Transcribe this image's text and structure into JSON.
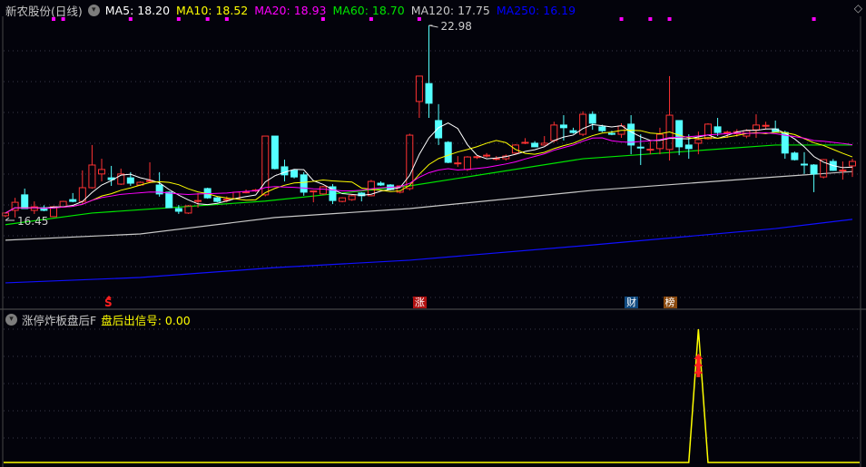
{
  "header": {
    "stock_name": "新农股份",
    "period": "(日线)",
    "ma_labels": [
      {
        "text": "MA5: 18.20",
        "color": "#ffffff"
      },
      {
        "text": "MA10: 18.52",
        "color": "#ffff00"
      },
      {
        "text": "MA20: 18.93",
        "color": "#ff00ff"
      },
      {
        "text": "MA60: 18.70",
        "color": "#00e600"
      },
      {
        "text": "MA120: 17.75",
        "color": "#c8c8c8"
      },
      {
        "text": "MA250: 16.19",
        "color": "#0000ff"
      }
    ],
    "collapse_icon": "chevron-down-circle-icon",
    "corner_icon": "diamond-icon"
  },
  "indicator": {
    "name": "涨停炸板盘后F",
    "signal_label": "盘后出信号: 0.00",
    "color": "#ffff00",
    "signal_index": 72
  },
  "annotations": {
    "high_label": "22.98",
    "low_label": "16.45",
    "s_mark": "S",
    "badges": [
      {
        "text": "涨",
        "index": 43,
        "bg": "#b01010"
      },
      {
        "text": "财",
        "index": 65,
        "bg": "#104a80"
      },
      {
        "text": "榜",
        "index": 69,
        "bg": "#8a4a10"
      }
    ]
  },
  "colors": {
    "up": "#ff3232",
    "down": "#54ffff",
    "background": "#03030b"
  },
  "chart_data": {
    "type": "candlestick",
    "title": "新农股份 (日线)",
    "ylim": [
      13.5,
      23.5
    ],
    "candles_ohlc": [
      [
        16.6,
        16.7,
        16.55,
        16.69
      ],
      [
        16.78,
        17.2,
        16.54,
        17.05
      ],
      [
        17.3,
        17.51,
        16.84,
        16.84
      ],
      [
        16.78,
        17.08,
        16.66,
        16.9
      ],
      [
        16.87,
        16.95,
        16.75,
        16.78
      ],
      [
        16.57,
        16.93,
        16.55,
        16.9
      ],
      [
        16.9,
        17.1,
        16.88,
        17.08
      ],
      [
        17.14,
        17.36,
        17.05,
        17.08
      ],
      [
        17.08,
        18.12,
        16.99,
        17.54
      ],
      [
        17.54,
        18.97,
        17.51,
        18.3
      ],
      [
        18.0,
        18.51,
        17.75,
        18.15
      ],
      [
        17.87,
        18.27,
        17.6,
        17.81
      ],
      [
        17.66,
        18.18,
        17.63,
        18.0
      ],
      [
        17.87,
        18.06,
        17.6,
        17.69
      ],
      [
        17.63,
        17.75,
        17.6,
        17.72
      ],
      [
        17.75,
        18.39,
        17.69,
        17.78
      ],
      [
        17.63,
        18.06,
        17.24,
        17.33
      ],
      [
        17.39,
        17.42,
        16.87,
        16.87
      ],
      [
        16.84,
        16.96,
        16.66,
        16.75
      ],
      [
        16.69,
        16.96,
        16.66,
        16.93
      ],
      [
        17.1,
        17.36,
        16.87,
        17.11
      ],
      [
        17.51,
        17.54,
        17.17,
        17.2
      ],
      [
        17.2,
        17.25,
        17.05,
        17.08
      ],
      [
        17.14,
        17.25,
        17.05,
        17.15
      ],
      [
        17.17,
        17.4,
        17.15,
        17.39
      ],
      [
        17.39,
        17.48,
        17.35,
        17.4
      ],
      [
        17.44,
        17.5,
        17.4,
        17.46
      ],
      [
        17.3,
        19.27,
        17.25,
        19.27
      ],
      [
        19.27,
        19.27,
        18.15,
        18.18
      ],
      [
        18.24,
        18.48,
        17.75,
        17.97
      ],
      [
        18.12,
        18.15,
        17.85,
        17.9
      ],
      [
        17.97,
        18.06,
        17.27,
        17.39
      ],
      [
        17.41,
        17.45,
        17.05,
        17.43
      ],
      [
        17.33,
        17.6,
        17.3,
        17.57
      ],
      [
        17.57,
        17.66,
        16.99,
        17.11
      ],
      [
        17.08,
        17.22,
        17.05,
        17.2
      ],
      [
        17.14,
        17.3,
        17.1,
        17.27
      ],
      [
        17.36,
        17.39,
        17.08,
        17.27
      ],
      [
        17.27,
        17.8,
        17.25,
        17.75
      ],
      [
        17.69,
        17.75,
        17.6,
        17.63
      ],
      [
        17.63,
        17.66,
        17.45,
        17.48
      ],
      [
        17.39,
        17.62,
        17.35,
        17.6
      ],
      [
        17.51,
        19.35,
        17.45,
        19.3
      ],
      [
        20.43,
        21.28,
        19.88,
        21.28
      ],
      [
        21.03,
        22.98,
        19.88,
        20.37
      ],
      [
        19.79,
        20.34,
        18.97,
        19.21
      ],
      [
        19.06,
        19.1,
        18.36,
        18.39
      ],
      [
        18.36,
        18.6,
        18.24,
        18.37
      ],
      [
        18.15,
        18.6,
        18.1,
        18.57
      ],
      [
        18.56,
        18.6,
        18.5,
        18.58
      ],
      [
        18.62,
        18.7,
        18.55,
        18.63
      ],
      [
        18.5,
        18.6,
        18.45,
        18.52
      ],
      [
        18.51,
        18.65,
        18.45,
        18.6
      ],
      [
        18.7,
        19.0,
        18.65,
        18.97
      ],
      [
        19.05,
        19.2,
        19.0,
        19.06
      ],
      [
        19.03,
        19.1,
        18.9,
        18.91
      ],
      [
        18.97,
        19.27,
        18.95,
        19.03
      ],
      [
        19.12,
        19.75,
        19.05,
        19.64
      ],
      [
        19.64,
        19.97,
        19.12,
        19.55
      ],
      [
        19.45,
        19.55,
        19.35,
        19.39
      ],
      [
        19.33,
        20.1,
        19.27,
        20.0
      ],
      [
        20.0,
        20.1,
        19.48,
        19.7
      ],
      [
        19.58,
        19.65,
        19.4,
        19.45
      ],
      [
        19.36,
        19.45,
        19.3,
        19.33
      ],
      [
        19.33,
        19.7,
        19.21,
        19.61
      ],
      [
        19.67,
        19.97,
        18.66,
        18.97
      ],
      [
        18.9,
        19.33,
        18.3,
        18.88
      ],
      [
        18.81,
        19.09,
        18.66,
        18.83
      ],
      [
        18.85,
        19.55,
        18.66,
        19.33
      ],
      [
        18.82,
        21.28,
        18.45,
        19.97
      ],
      [
        19.79,
        19.79,
        18.63,
        18.91
      ],
      [
        18.97,
        19.33,
        18.51,
        18.85
      ],
      [
        19.03,
        19.42,
        18.66,
        19.15
      ],
      [
        19.18,
        19.7,
        19.15,
        19.67
      ],
      [
        19.58,
        19.88,
        19.27,
        19.39
      ],
      [
        19.38,
        19.45,
        19.21,
        19.4
      ],
      [
        19.35,
        19.5,
        19.25,
        19.42
      ],
      [
        19.27,
        19.5,
        19.2,
        19.45
      ],
      [
        19.48,
        20.0,
        19.21,
        19.64
      ],
      [
        19.62,
        19.75,
        19.5,
        19.63
      ],
      [
        19.51,
        19.79,
        19.4,
        19.42
      ],
      [
        19.39,
        19.45,
        18.51,
        18.7
      ],
      [
        18.7,
        18.75,
        18.45,
        18.48
      ],
      [
        18.33,
        18.73,
        18.0,
        18.32
      ],
      [
        18.3,
        18.33,
        17.39,
        18.0
      ],
      [
        17.9,
        18.5,
        17.85,
        18.48
      ],
      [
        18.42,
        18.5,
        18.1,
        18.12
      ],
      [
        18.11,
        18.42,
        17.81,
        18.13
      ],
      [
        18.27,
        18.51,
        17.9,
        18.42
      ]
    ],
    "ma_long": [
      {
        "name": "MA60",
        "color": "#00e600",
        "points": [
          [
            0,
            16.3
          ],
          [
            9,
            16.69
          ],
          [
            27,
            17.09
          ],
          [
            42,
            17.6
          ],
          [
            60,
            18.51
          ],
          [
            80,
            18.97
          ],
          [
            88,
            18.97
          ]
        ]
      },
      {
        "name": "MA120",
        "color": "#c8c8c8",
        "points": [
          [
            0,
            15.78
          ],
          [
            14,
            15.99
          ],
          [
            28,
            16.54
          ],
          [
            42,
            16.84
          ],
          [
            61,
            17.45
          ],
          [
            80,
            17.9
          ],
          [
            88,
            18.08
          ]
        ]
      },
      {
        "name": "MA250",
        "color": "#1010ff",
        "points": [
          [
            0,
            14.35
          ],
          [
            14,
            14.53
          ],
          [
            28,
            14.86
          ],
          [
            42,
            15.11
          ],
          [
            61,
            15.62
          ],
          [
            80,
            16.17
          ],
          [
            88,
            16.48
          ]
        ]
      }
    ],
    "ma_short": [
      {
        "name": "MA5",
        "period": 5,
        "color": "#ffffff"
      },
      {
        "name": "MA10",
        "period": 10,
        "color": "#ffff00"
      },
      {
        "name": "MA20",
        "period": 20,
        "color": "#ff00ff"
      }
    ],
    "signal_marks_indices": [
      5,
      6,
      13,
      18,
      21,
      23,
      33,
      38,
      43,
      64,
      67,
      69,
      84
    ]
  }
}
